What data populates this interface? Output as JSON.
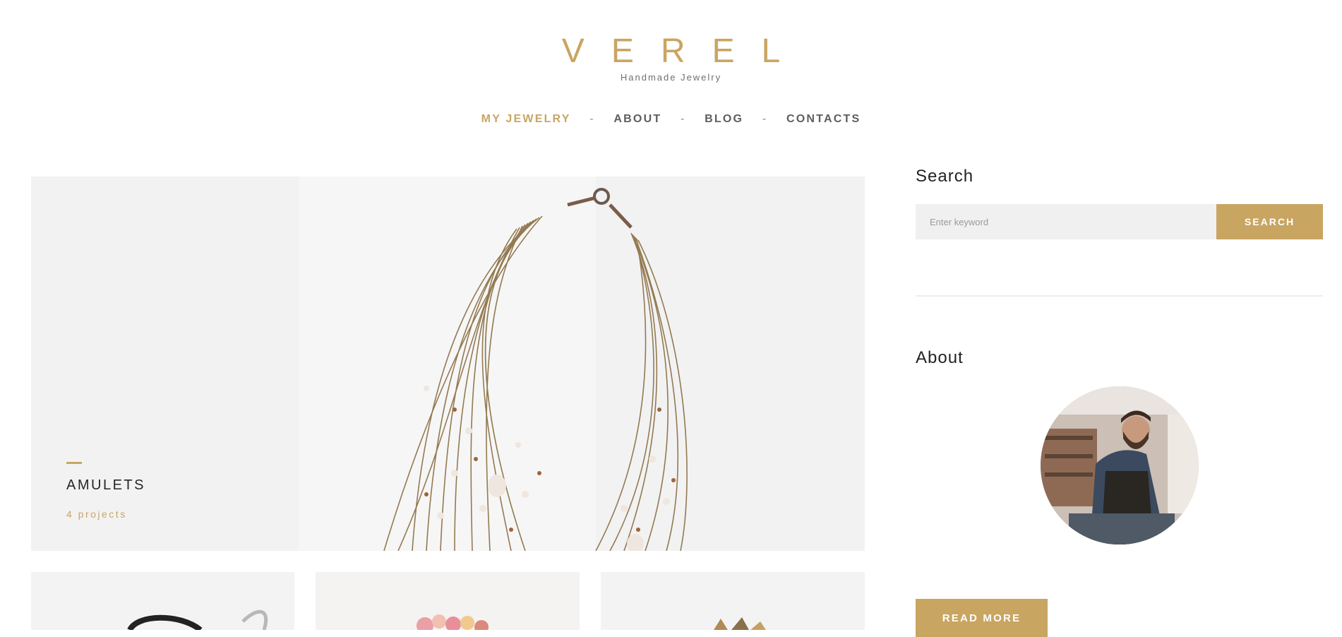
{
  "header": {
    "logo": "VEREL",
    "tagline": "Handmade Jewelry"
  },
  "nav": {
    "items": [
      "MY JEWELRY",
      "ABOUT",
      "BLOG",
      "CONTACTS"
    ],
    "separator": "-",
    "active_index": 0
  },
  "hero": {
    "category_title": "AMULETS",
    "category_count": "4 projects",
    "image_icon": "necklace-photo"
  },
  "thumbnails": {
    "icons": [
      "bracelet-photo",
      "flower-jewelry-photo",
      "brooch-photo"
    ]
  },
  "sidebar": {
    "search": {
      "heading": "Search",
      "placeholder": "Enter keyword",
      "button_label": "SEARCH"
    },
    "about": {
      "heading": "About",
      "avatar_icon": "craftsman-photo",
      "button_label": "READ MORE"
    }
  },
  "colors": {
    "accent": "#c9a562",
    "text_dark": "#222222",
    "nav_text": "#5e5e5e",
    "input_bg": "#f0f0f0"
  }
}
